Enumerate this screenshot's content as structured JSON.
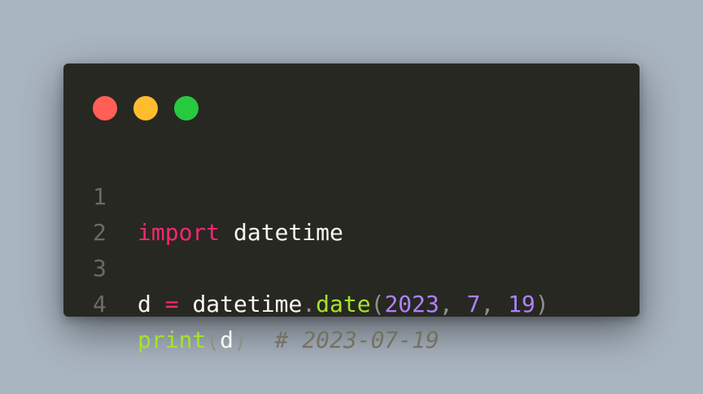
{
  "window": {
    "controls": {
      "close_color": "#ff5f56",
      "minimize_color": "#ffbd2e",
      "maximize_color": "#27c93f"
    }
  },
  "code": {
    "line_numbers": [
      "1",
      "2",
      "3",
      "4"
    ],
    "line1": {
      "keyword": "import",
      "module": "datetime"
    },
    "line3": {
      "var": "d",
      "op": "=",
      "obj": "datetime",
      "dot": ".",
      "method": "date",
      "lparen": "(",
      "year": "2023",
      "comma1": ",",
      "month": "7",
      "comma2": ",",
      "day": "19",
      "rparen": ")"
    },
    "line4": {
      "func": "print",
      "lparen": "(",
      "arg": "d",
      "rparen": ")",
      "comment": "# 2023-07-19"
    }
  }
}
